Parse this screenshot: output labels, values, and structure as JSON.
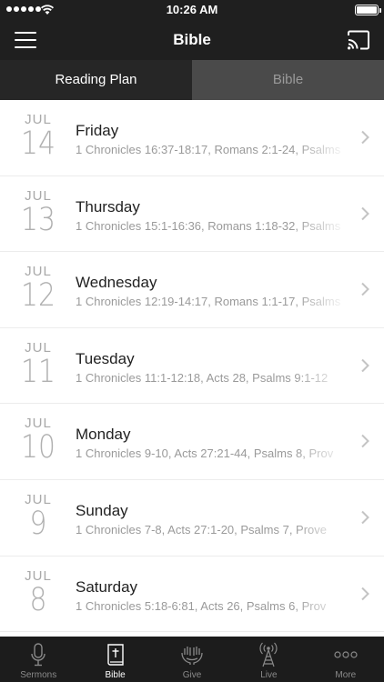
{
  "status_bar": {
    "time": "10:26 AM"
  },
  "nav": {
    "title": "Bible"
  },
  "tabs": [
    {
      "label": "Reading Plan",
      "active": true
    },
    {
      "label": "Bible",
      "active": false
    }
  ],
  "readings": [
    {
      "month": "JUL",
      "day": "14",
      "weekday": "Friday",
      "passages": "1 Chronicles 16:37-18:17, Romans 2:1-24, Psalms"
    },
    {
      "month": "JUL",
      "day": "13",
      "weekday": "Thursday",
      "passages": "1 Chronicles 15:1-16:36, Romans 1:18-32, Psalms"
    },
    {
      "month": "JUL",
      "day": "12",
      "weekday": "Wednesday",
      "passages": "1 Chronicles 12:19-14:17, Romans 1:1-17, Psalms"
    },
    {
      "month": "JUL",
      "day": "11",
      "weekday": "Tuesday",
      "passages": "1 Chronicles 11:1-12:18, Acts 28, Psalms 9:1-12"
    },
    {
      "month": "JUL",
      "day": "10",
      "weekday": "Monday",
      "passages": "1 Chronicles 9-10, Acts 27:21-44, Psalms 8, Prov"
    },
    {
      "month": "JUL",
      "day": "9",
      "weekday": "Sunday",
      "passages": "1 Chronicles 7-8, Acts 27:1-20, Psalms 7, Prove"
    },
    {
      "month": "JUL",
      "day": "8",
      "weekday": "Saturday",
      "passages": "1 Chronicles 5:18-6:81, Acts 26, Psalms 6, Prov"
    }
  ],
  "tabbar": [
    {
      "label": "Sermons",
      "icon": "microphone-icon",
      "active": false
    },
    {
      "label": "Bible",
      "icon": "bible-icon",
      "active": true
    },
    {
      "label": "Give",
      "icon": "give-hands-icon",
      "active": false
    },
    {
      "label": "Live",
      "icon": "broadcast-tower-icon",
      "active": false
    },
    {
      "label": "More",
      "icon": "more-dots-icon",
      "active": false
    }
  ]
}
